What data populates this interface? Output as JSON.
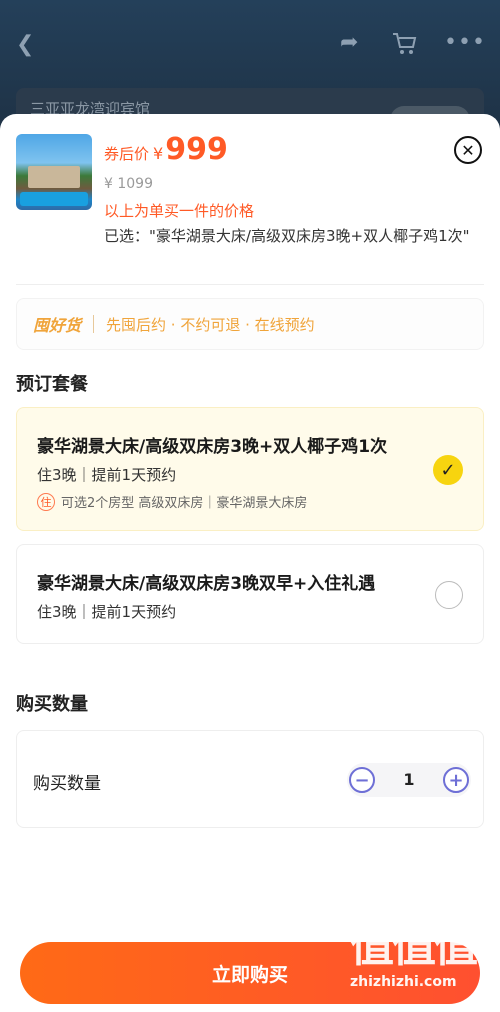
{
  "background": {
    "card_title": "三亚亚龙湾迎宾馆",
    "icons": [
      "back-icon",
      "share-icon",
      "cart-icon",
      "more-icon"
    ]
  },
  "product": {
    "price_tag": "券后价",
    "currency": "¥",
    "price": "999",
    "original_price": "¥ 1099",
    "unit_note": "以上为单买一件的价格",
    "selected": "已选：\"豪华湖景大床/高级双床房3晚+双人椰子鸡1次\""
  },
  "promo": {
    "logo": "囤好货",
    "text": "先囤后约 · 不约可退 · 在线预约"
  },
  "packages": {
    "title": "预订套餐",
    "items": [
      {
        "name": "豪华湖景大床/高级双床房3晚+双人椰子鸡1次",
        "meta": "住3晚｜提前1天预约",
        "room_badge": "住",
        "room_text": "可选2个房型 高级双床房｜豪华湖景大床房",
        "selected": true
      },
      {
        "name": "豪华湖景大床/高级双床房3晚双早+入住礼遇",
        "meta": "住3晚｜提前1天预约",
        "selected": false
      }
    ]
  },
  "quantity": {
    "title": "购买数量",
    "label": "购买数量",
    "value": "1",
    "minus": "−",
    "plus": "+"
  },
  "buy_button": "立即购买",
  "watermark": {
    "glyphs": "值值值",
    "url": "zhizhizhi.com"
  },
  "colors": {
    "accent": "#ff5a26",
    "promo": "#f0a43a",
    "check": "#f7d40f",
    "stepper": "#6e6fd6"
  }
}
